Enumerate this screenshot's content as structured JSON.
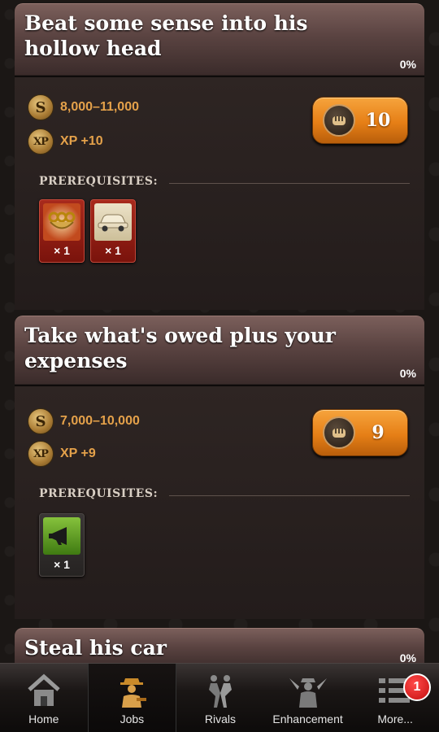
{
  "jobs": [
    {
      "title": "Beat some sense into his hollow head",
      "progress": "0%",
      "cash": "8,000–11,000",
      "xp": "XP +10",
      "energy_cost": "10",
      "prereq_label": "PREREQUISITES:",
      "items": [
        {
          "icon": "brass-knuckles-icon",
          "qty": "× 1"
        },
        {
          "icon": "car-icon",
          "qty": "× 1"
        }
      ]
    },
    {
      "title": "Take what's owed plus your expenses",
      "progress": "0%",
      "cash": "7,000–10,000",
      "xp": "XP +9",
      "energy_cost": "9",
      "prereq_label": "PREREQUISITES:",
      "items": [
        {
          "icon": "megaphone-icon",
          "qty": "× 1"
        }
      ]
    },
    {
      "title": "Steal his car",
      "progress": "0%"
    }
  ],
  "icons": {
    "cash": "S",
    "xp": "XP"
  },
  "tabs": [
    {
      "label": "Home",
      "icon": "home-icon",
      "active": false
    },
    {
      "label": "Jobs",
      "icon": "gangster-icon",
      "active": true
    },
    {
      "label": "Rivals",
      "icon": "fighters-icon",
      "active": false
    },
    {
      "label": "Enhancement",
      "icon": "dual-pistols-icon",
      "active": false
    },
    {
      "label": "More...",
      "icon": "list-icon",
      "active": false,
      "badge": "1"
    }
  ],
  "colors": {
    "accent_orange": "#e67f16",
    "reward_text": "#e4a14a",
    "badge_red": "#d41414"
  }
}
